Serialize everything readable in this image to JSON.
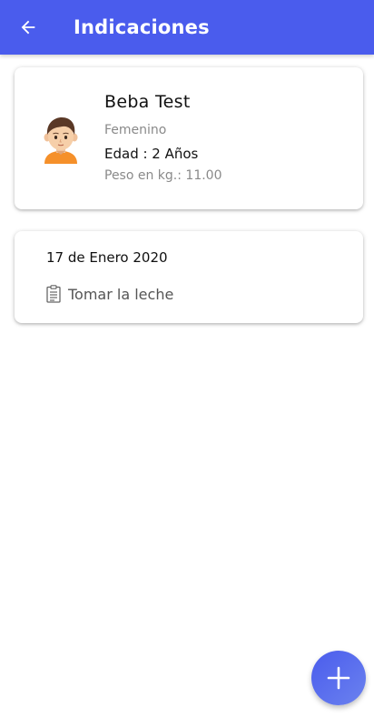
{
  "colors": {
    "primary": "#4a5ced",
    "fab_gradient_start": "#4a5ced",
    "fab_gradient_end": "#6b82ee"
  },
  "appbar": {
    "title": "Indicaciones",
    "back_icon": "arrow-left-icon"
  },
  "profile": {
    "name": "Beba Test",
    "gender": "Femenino",
    "age": "Edad : 2 Años",
    "weight": "Peso en kg.: 11.00",
    "avatar_icon": "child-avatar-icon"
  },
  "indications": [
    {
      "date": "17 de Enero 2020",
      "text": "Tomar la leche",
      "icon": "clipboard-icon"
    }
  ],
  "fab": {
    "icon": "plus-icon"
  }
}
